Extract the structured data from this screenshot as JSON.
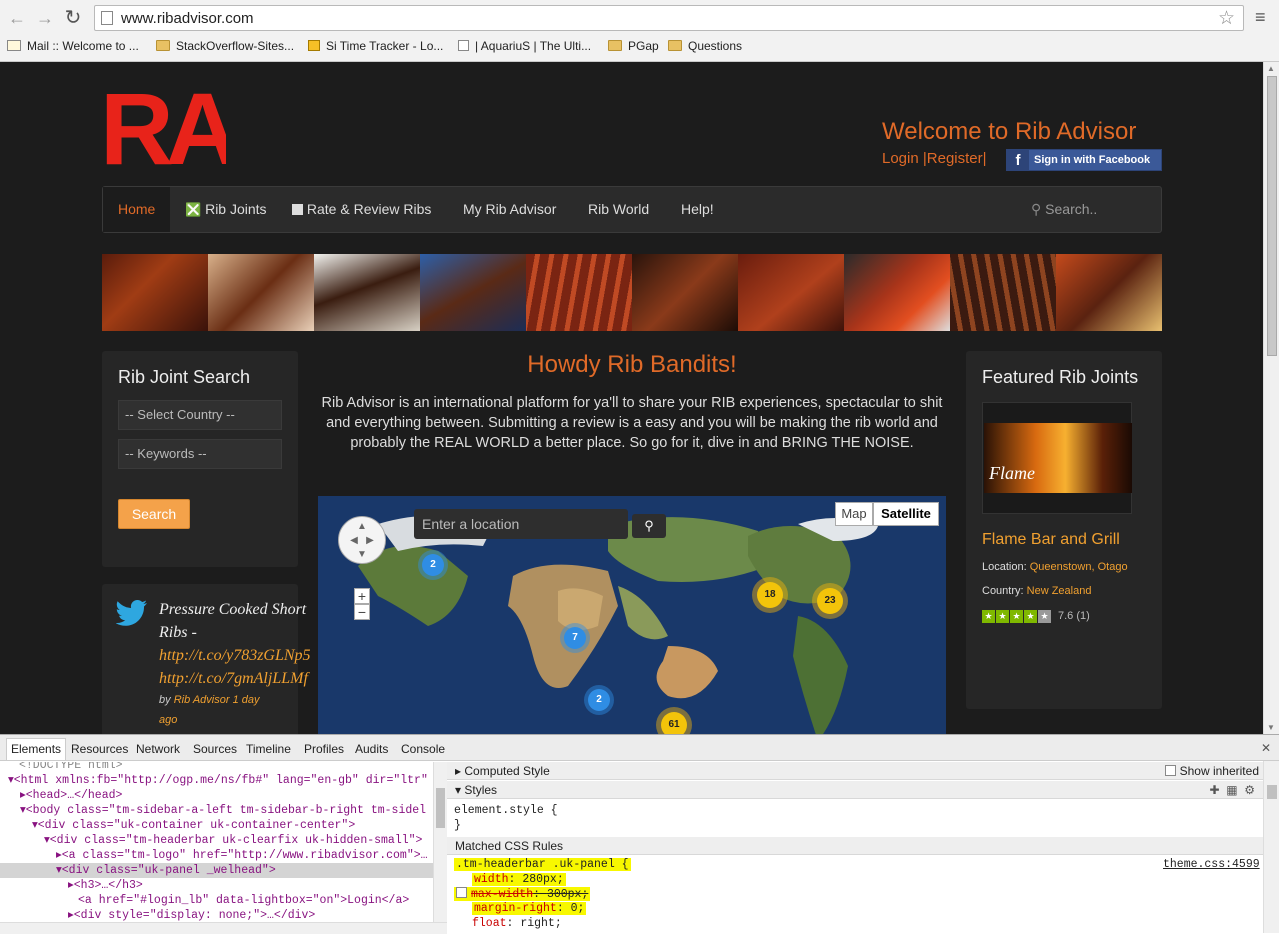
{
  "browser": {
    "url": "www.ribadvisor.com",
    "bookmarks": [
      {
        "label": "Mail :: Welcome to ...",
        "icon": "mail-icon"
      },
      {
        "label": "StackOverflow-Sites...",
        "icon": "folder-icon"
      },
      {
        "label": "Si Time Tracker - Lo...",
        "icon": "tracker-icon"
      },
      {
        "label": "| AquariuS | The Ulti...",
        "icon": "page-icon"
      },
      {
        "label": "PGap",
        "icon": "folder-icon"
      },
      {
        "label": "Questions",
        "icon": "folder-icon"
      }
    ]
  },
  "site": {
    "logo": "RA",
    "welcome": "Welcome to Rib Advisor",
    "login": "Login",
    "register": "Register",
    "facebook": "Sign in with Facebook",
    "nav": [
      "Home",
      "Rib Joints",
      "Rate & Review Ribs",
      "My Rib Advisor",
      "Rib World",
      "Help!"
    ],
    "nav_search_placeholder": "Search..",
    "sidebar": {
      "title": "Rib Joint Search",
      "country_placeholder": "-- Select Country --",
      "keywords_placeholder": "-- Keywords --",
      "search_button": "Search"
    },
    "tweet": {
      "text": "Pressure Cooked Short Ribs -",
      "link1": "http://t.co/y783zGLNp5",
      "link2": "http://t.co/7gmAljLLMf",
      "by_prefix": "by",
      "author": "Rib Advisor",
      "time": "1 day ago"
    },
    "main": {
      "heading": "Howdy Rib Bandits!",
      "intro": "Rib Advisor is an international platform for ya'll to share your RIB experiences, spectacular to shit and everything between. Submitting a review is a easy and you will be making the rib world and probably the REAL WORLD a better place. So go for it, dive in and BRING THE NOISE."
    },
    "map": {
      "location_placeholder": "Enter a location",
      "map_button": "Map",
      "satellite_button": "Satellite",
      "clusters": [
        2,
        18,
        23,
        7,
        2,
        61
      ]
    },
    "featured": {
      "title": "Featured Rib Joints",
      "name": "Flame Bar and Grill",
      "location_label": "Location:",
      "location": "Queenstown, Otago",
      "country_label": "Country:",
      "country": "New Zealand",
      "image_text": "Flame",
      "rating_stars": 4,
      "rating_text": "7.6 (1)"
    }
  },
  "devtools": {
    "tabs": [
      "Elements",
      "Resources",
      "Network",
      "Sources",
      "Timeline",
      "Profiles",
      "Audits",
      "Console"
    ],
    "computed_style": "Computed Style",
    "show_inherited": "Show inherited",
    "styles_label": "Styles",
    "element_style": "element.style {",
    "closing_brace": "}",
    "matched_rules": "Matched CSS Rules",
    "rule_selector": ".tm-headerbar .uk-panel {",
    "rule_source": "theme.css:4599",
    "rule_props": [
      {
        "prop": "width",
        "val": "280px;"
      },
      {
        "prop": "max-width",
        "val": "300px;"
      },
      {
        "prop": "margin-right",
        "val": "0;"
      },
      {
        "prop": "float",
        "val": "right;"
      }
    ],
    "dom_lines": [
      "<!DOCTYPE html>",
      "<html xmlns:fb=\"http://ogp.me/ns/fb#\" lang=\"en-gb\" dir=\"ltr\"",
      "<head>…</head>",
      "<body class=\"tm-sidebar-a-left tm-sidebar-b-right tm-sidel",
      "<div class=\"uk-container uk-container-center\">",
      "<div class=\"tm-headerbar uk-clearfix uk-hidden-small\">",
      "<a class=\"tm-logo\" href=\"http://www.ribadvisor.com\">…",
      "<div class=\"uk-panel  _welhead\">",
      "<h3>…</h3>",
      "<a href=\"#login_lb\" data-lightbox=\"on\">Login</a>",
      "<div style=\"display: none;\">…</div>"
    ]
  }
}
